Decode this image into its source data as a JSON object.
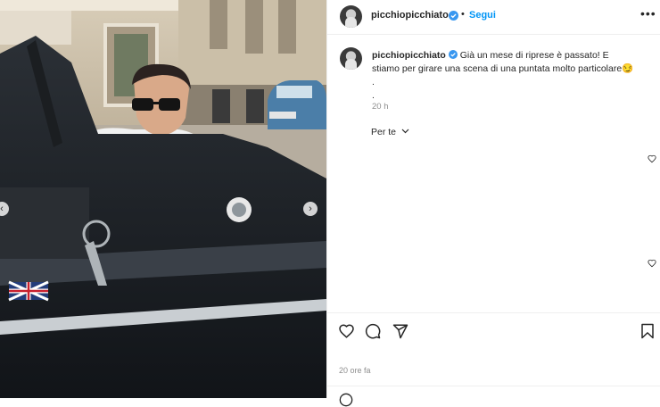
{
  "post": {
    "username": "picchiopicchiato",
    "dot": "•",
    "follow_label": "Segui",
    "more_icon": "more-horizontal-icon",
    "caption_username": "picchiopicchiato",
    "caption_line1": "Già un mese di riprese è passato! E",
    "caption_line2": "stiamo per girare una scena di una puntata molto particolare😏",
    "caption_dot1": ".",
    "caption_dot2": ".",
    "caption_time": "20 h",
    "filter_label": "Per te",
    "timestamp": "20 ore fa"
  },
  "icons": {
    "like": "heart-icon",
    "comment": "comment-icon",
    "share": "share-icon",
    "save": "bookmark-icon",
    "verified": "verified-badge-icon",
    "prev": "chevron-left-icon",
    "next": "chevron-right-icon"
  },
  "colors": {
    "accent": "#0095f6",
    "verified": "#3897f0",
    "text": "#262626",
    "muted": "#8e8e8e"
  }
}
